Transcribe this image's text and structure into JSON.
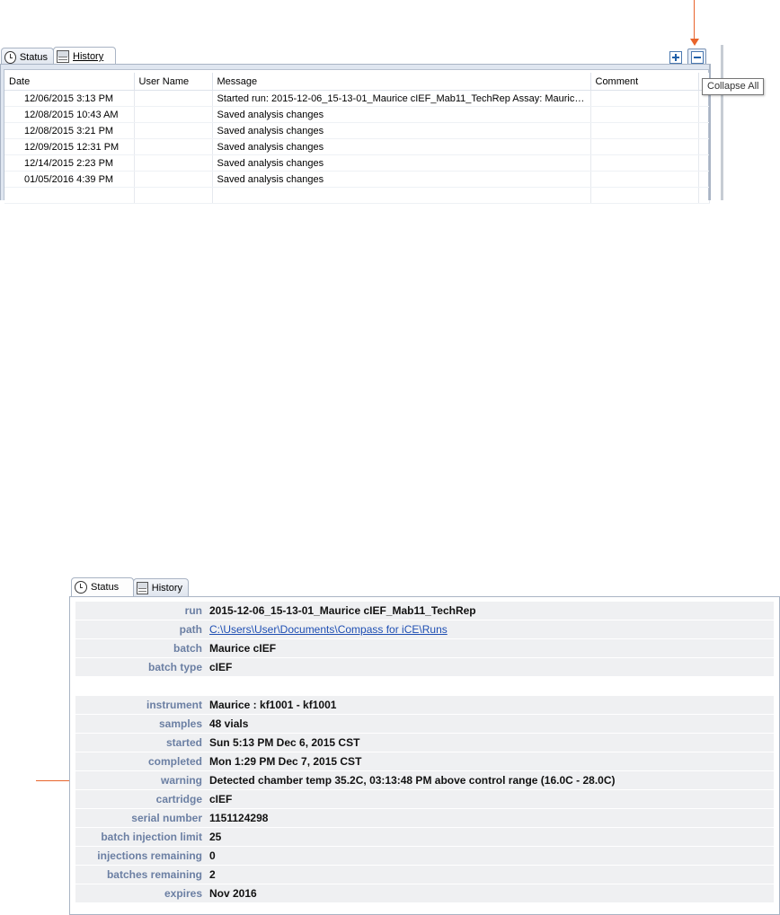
{
  "tabs": {
    "status": "Status",
    "history": "History"
  },
  "history": {
    "columns": [
      "Date",
      "User Name",
      "Message",
      "Comment"
    ],
    "rows": [
      {
        "date": "12/06/2015 3:13 PM",
        "user": "",
        "message": "Started run: 2015-12-06_15-13-01_Maurice cIEF_Mab11_TechRep  Assay: Mauric…",
        "comment": ""
      },
      {
        "date": "12/08/2015 10:43 AM",
        "user": "",
        "message": "Saved analysis changes",
        "comment": ""
      },
      {
        "date": "12/08/2015 3:21 PM",
        "user": "",
        "message": "Saved analysis changes",
        "comment": ""
      },
      {
        "date": "12/09/2015 12:31 PM",
        "user": "",
        "message": "Saved analysis changes",
        "comment": ""
      },
      {
        "date": "12/14/2015 2:23 PM",
        "user": "",
        "message": "Saved analysis changes",
        "comment": ""
      },
      {
        "date": "01/05/2016 4:39 PM",
        "user": "",
        "message": "Saved analysis changes",
        "comment": ""
      }
    ],
    "tooltip": "Collapse All",
    "icons": {
      "expand": "expand-all-icon",
      "collapse": "collapse-all-icon"
    }
  },
  "status": {
    "run": {
      "label": "run",
      "value": "2015-12-06_15-13-01_Maurice cIEF_Mab11_TechRep"
    },
    "path": {
      "label": "path",
      "value": "C:\\Users\\User\\Documents\\Compass for iCE\\Runs"
    },
    "batch": {
      "label": "batch",
      "value": "Maurice cIEF"
    },
    "batch_type": {
      "label": "batch type",
      "value": "cIEF"
    },
    "instrument": {
      "label": "instrument",
      "value": "Maurice : kf1001 - kf1001"
    },
    "samples": {
      "label": "samples",
      "value": "48 vials"
    },
    "started": {
      "label": "started",
      "value": "Sun 5:13 PM Dec 6, 2015 CST"
    },
    "completed": {
      "label": "completed",
      "value": "Mon 1:29 PM Dec 7, 2015 CST"
    },
    "warning": {
      "label": "warning",
      "value": "Detected chamber temp 35.2C, 03:13:48 PM above control range (16.0C - 28.0C)"
    },
    "cartridge": {
      "label": "cartridge",
      "value": "cIEF"
    },
    "serial_number": {
      "label": "serial number",
      "value": "1151124298"
    },
    "batch_injection_limit": {
      "label": "batch injection limit",
      "value": "25"
    },
    "injections_remaining": {
      "label": "injections remaining",
      "value": "0"
    },
    "batches_remaining": {
      "label": "batches remaining",
      "value": "2"
    },
    "expires": {
      "label": "expires",
      "value": "Nov 2016"
    }
  },
  "colors": {
    "annotation_arrow": "#e8642c",
    "label": "#6b7fa3",
    "link": "#1f4fb3",
    "row_bg": "#eff0f2"
  }
}
